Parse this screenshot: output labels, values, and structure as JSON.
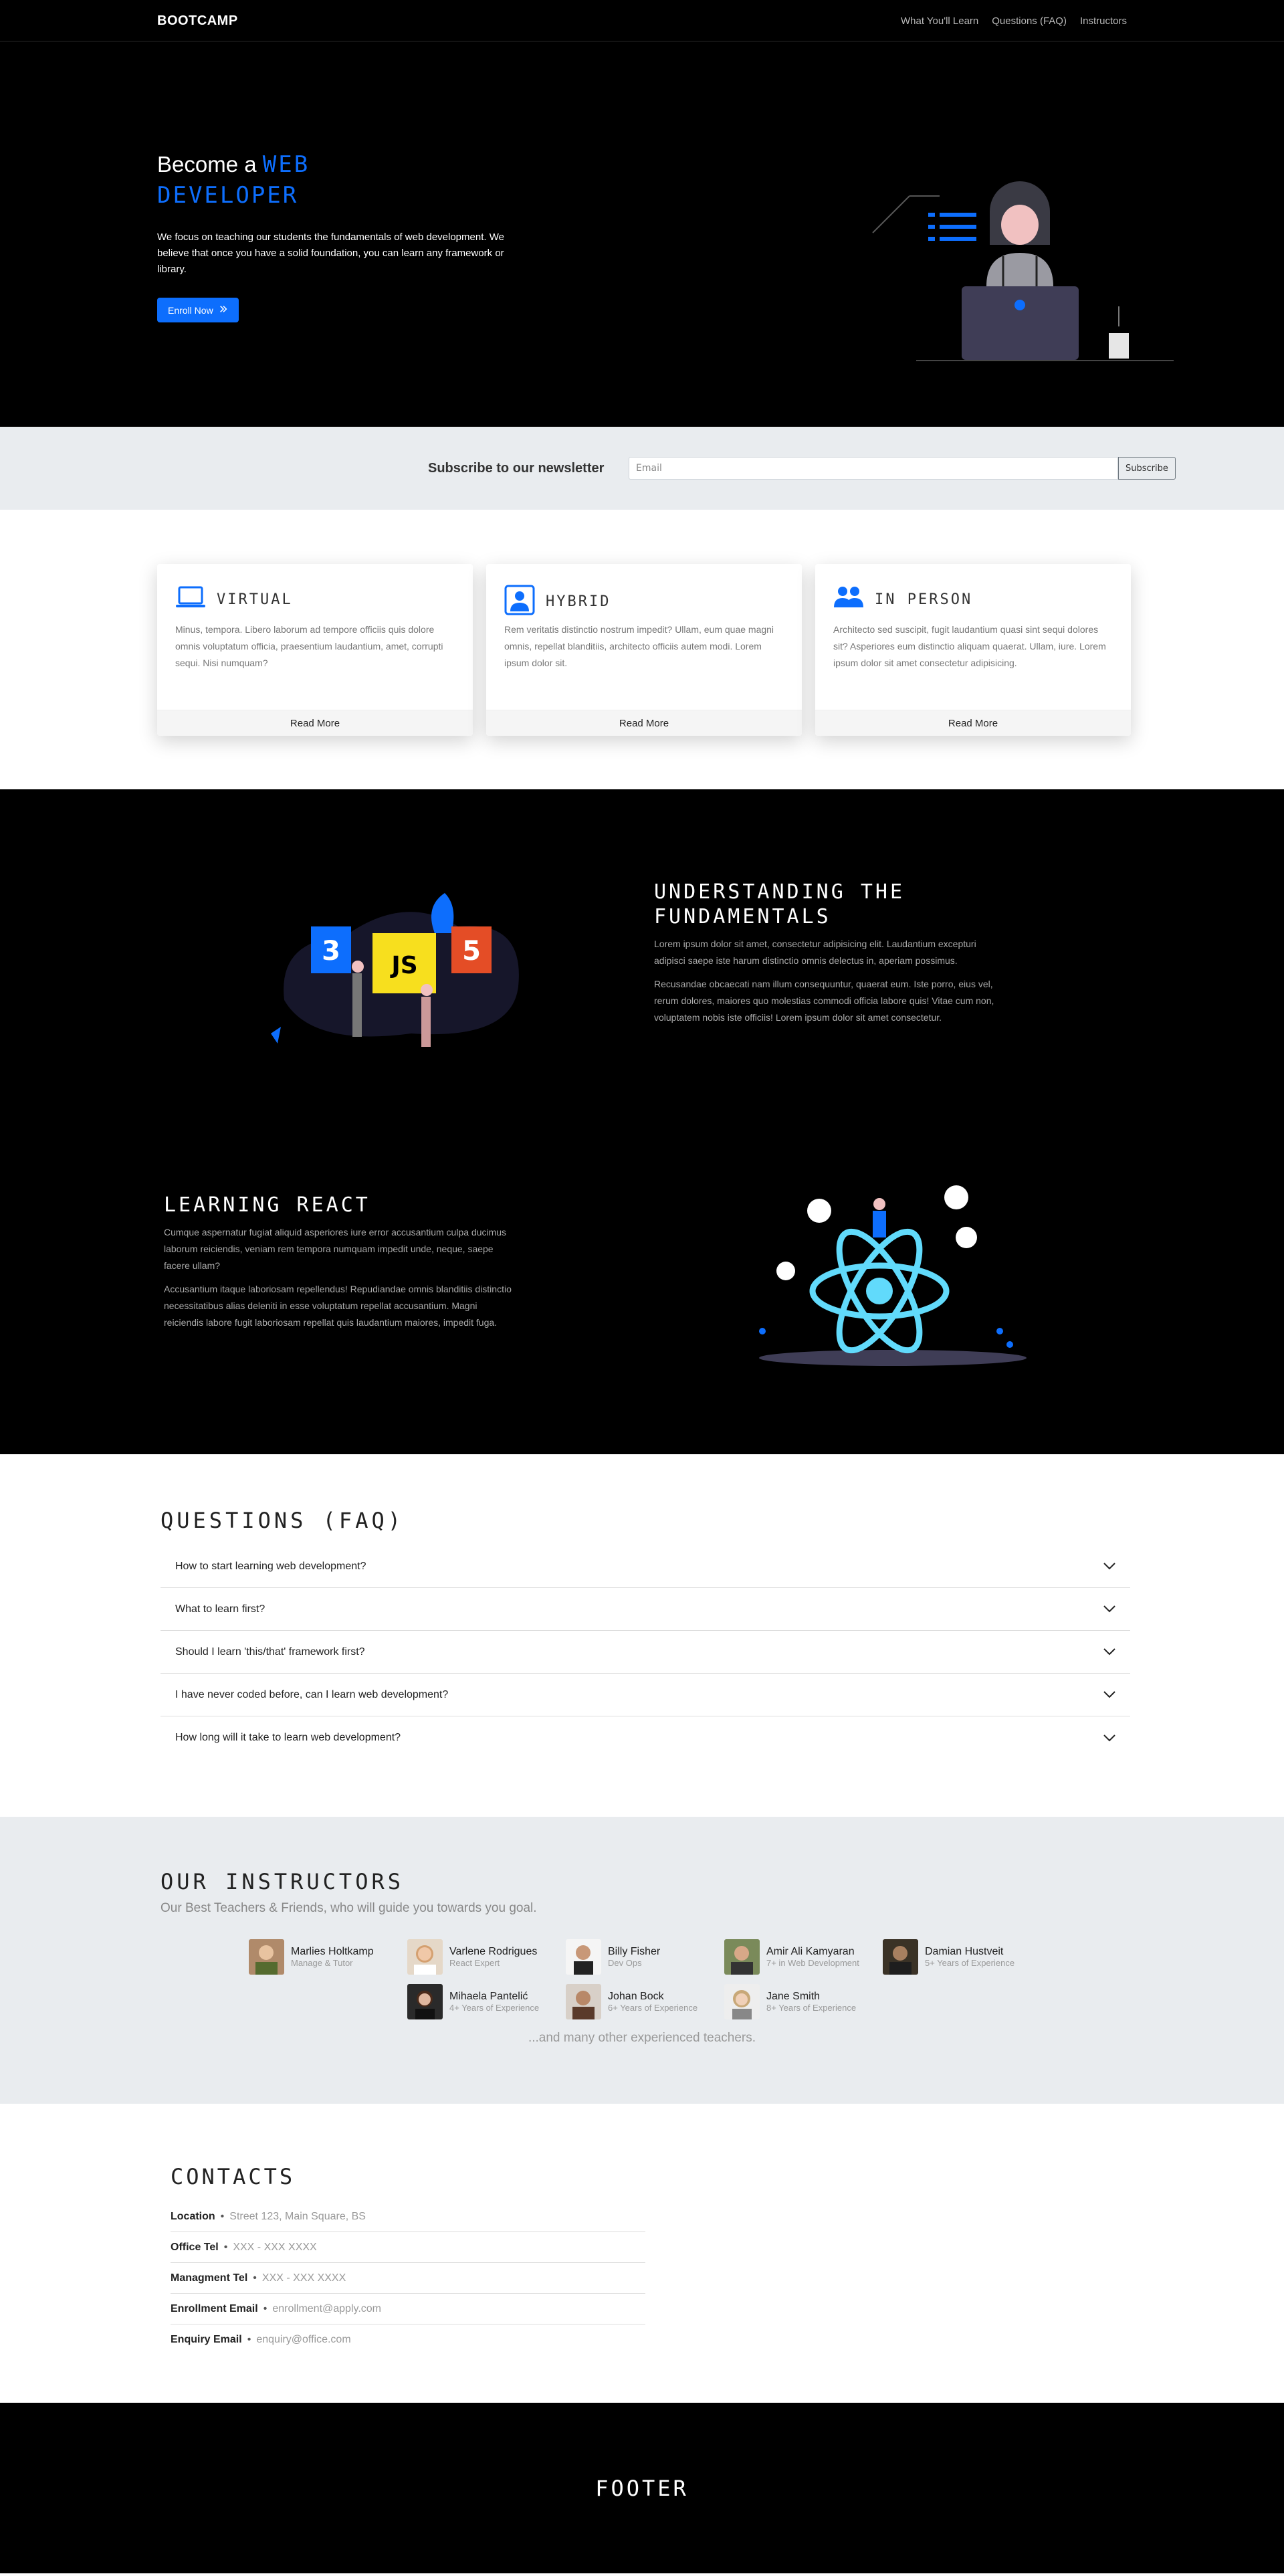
{
  "nav": {
    "brand": "BOOTCAMP",
    "links": [
      "What You'll Learn",
      "Questions (FAQ)",
      "Instructors"
    ]
  },
  "hero": {
    "title_prefix": "Become a",
    "title_accent_1": "WEB",
    "title_accent_2": "DEVELOPER",
    "lead": "We focus on teaching our students the fundamentals of web development. We believe that once you have a solid foundation, you can learn any framework or library.",
    "button": "Enroll Now"
  },
  "newsletter": {
    "title": "Subscribe to our newsletter",
    "placeholder": "Email",
    "button": "Subscribe"
  },
  "cards": [
    {
      "icon": "laptop-icon",
      "title": "VIRTUAL",
      "body": "Minus, tempora. Libero laborum ad tempore officiis quis dolore omnis voluptatum officia, praesentium laudantium, amet, corrupti sequi. Nisi numquam?",
      "link": "Read More"
    },
    {
      "icon": "person-badge-icon",
      "title": "HYBRID",
      "body": "Rem veritatis distinctio nostrum impedit? Ullam, eum quae magni omnis, repellat blanditiis, architecto officiis autem modi. Lorem ipsum dolor sit.",
      "link": "Read More"
    },
    {
      "icon": "people-icon",
      "title": "IN PERSON",
      "body": "Architecto sed suscipit, fugit laudantium quasi sint sequi dolores sit? Asperiores eum distinctio aliquam quaerat. Ullam, iure. Lorem ipsum dolor sit amet consectetur adipisicing.",
      "link": "Read More"
    }
  ],
  "fundamentals": {
    "title_1": "UNDERSTANDING THE",
    "title_2": "FUNDAMENTALS",
    "p1": "Lorem ipsum dolor sit amet, consectetur adipisicing elit. Laudantium excepturi adipisci saepe iste harum distinctio omnis delectus in, aperiam possimus.",
    "p2": "Recusandae obcaecati nam illum consequuntur, quaerat eum. Iste porro, eius vel, rerum dolores, maiores quo molestias commodi officia labore quis! Vitae cum non, voluptatem nobis iste officiis! Lorem ipsum dolor sit amet consectetur."
  },
  "react": {
    "title": "LEARNING REACT",
    "p1": "Cumque aspernatur fugiat aliquid asperiores iure error accusantium culpa ducimus laborum reiciendis, veniam rem tempora numquam impedit unde, neque, saepe facere ullam?",
    "p2": "Accusantium itaque laboriosam repellendus! Repudiandae omnis blanditiis distinctio necessitatibus alias deleniti in esse voluptatum repellat accusantium. Magni reiciendis labore fugit laboriosam repellat quis laudantium maiores, impedit fuga."
  },
  "faq": {
    "title": "QUESTIONS (FAQ)",
    "items": [
      "How to start learning web development?",
      "What to learn first?",
      "Should I learn 'this/that' framework first?",
      "I have never coded before, can I learn web development?",
      "How long will it take to learn web development?"
    ]
  },
  "instructors": {
    "title": "OUR INSTRUCTORS",
    "subtitle": "Our Best Teachers & Friends, who will guide you towards you goal.",
    "people": [
      {
        "name": "Marlies Holtkamp",
        "role": "Manage & Tutor"
      },
      {
        "name": "Varlene Rodrigues",
        "role": "React Expert"
      },
      {
        "name": "Billy Fisher",
        "role": "Dev Ops"
      },
      {
        "name": "Amir Ali Kamyaran",
        "role": "7+ in Web Development"
      },
      {
        "name": "Damian Hustveit",
        "role": "5+ Years of Experience"
      },
      {
        "name": "Mihaela Pantelić",
        "role": "4+ Years of Experience"
      },
      {
        "name": "Johan Bock",
        "role": "6+ Years of Experience"
      },
      {
        "name": "Jane Smith",
        "role": "8+ Years of Experience"
      }
    ],
    "more": "...and many other experienced teachers."
  },
  "contacts": {
    "title": "CONTACTS",
    "rows": [
      {
        "label": "Location",
        "value": "Street 123, Main Square, BS"
      },
      {
        "label": "Office Tel",
        "value": "XXX - XXX XXXX"
      },
      {
        "label": "Managment Tel",
        "value": "XXX - XXX XXXX"
      },
      {
        "label": "Enrollment Email",
        "value": "enrollment@apply.com"
      },
      {
        "label": "Enquiry Email",
        "value": "enquiry@office.com"
      }
    ]
  },
  "footer": {
    "text": "FOOTER"
  },
  "colors": {
    "accent": "#0d6efd",
    "dark": "#000000",
    "light_band": "#e9ecef"
  }
}
